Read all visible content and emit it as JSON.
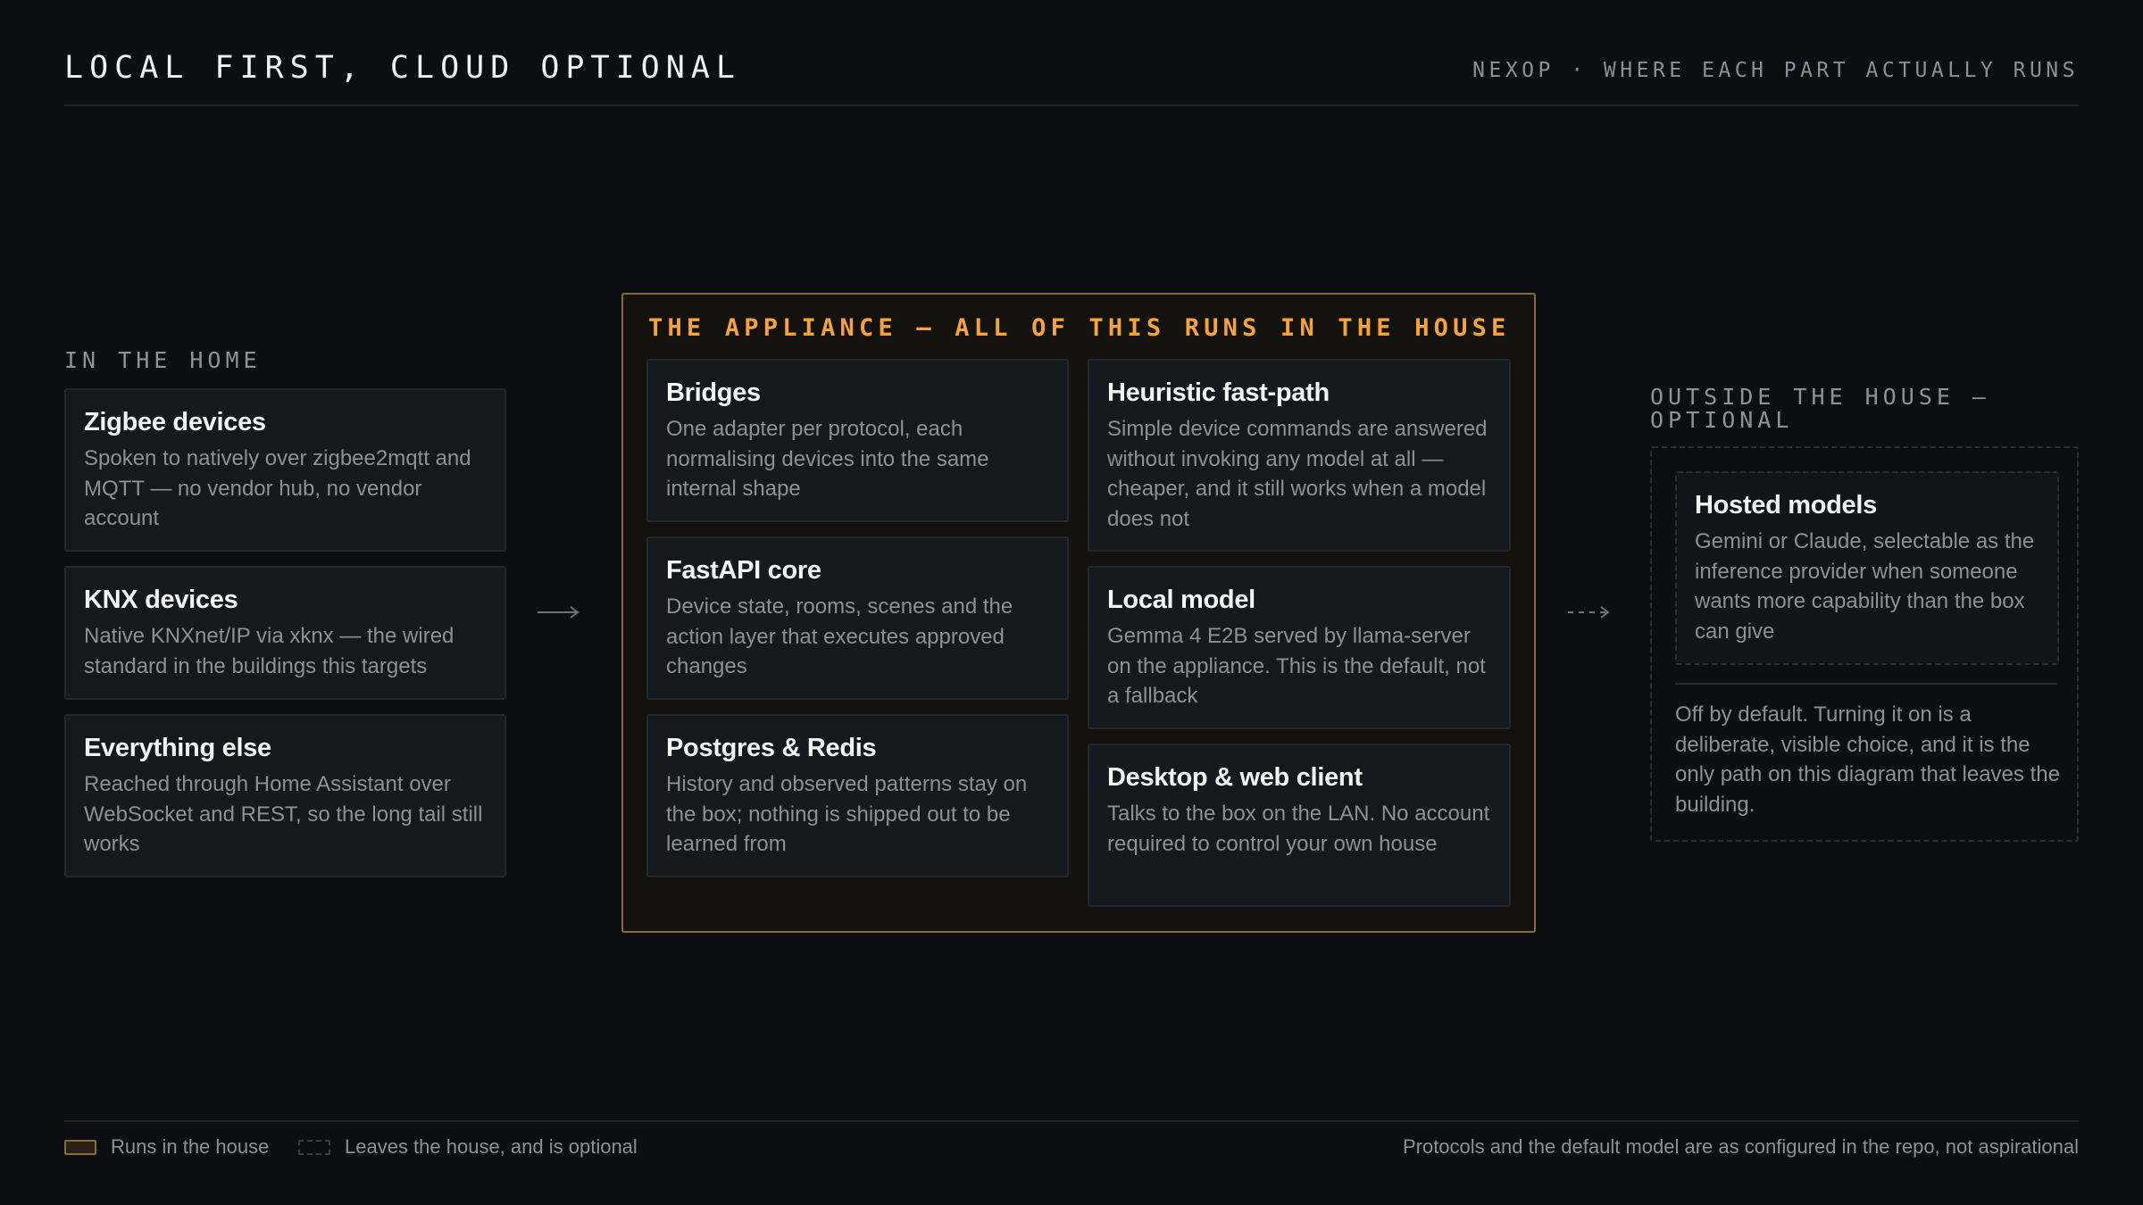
{
  "header": {
    "title": "LOCAL FIRST, CLOUD OPTIONAL",
    "subtitle": "NEXOP · WHERE EACH PART ACTUALLY RUNS"
  },
  "home": {
    "label": "IN THE HOME",
    "cards": [
      {
        "title": "Zigbee devices",
        "body": "Spoken to natively over zigbee2mqtt and MQTT — no vendor hub, no vendor account"
      },
      {
        "title": "KNX devices",
        "body": "Native KNXnet/IP via xknx — the wired standard in the buildings this targets"
      },
      {
        "title": "Everything else",
        "body": "Reached through Home Assistant over WebSocket and REST, so the long tail still works"
      }
    ]
  },
  "appliance": {
    "label": "THE APPLIANCE — ALL OF THIS RUNS IN THE HOUSE",
    "cards": [
      {
        "title": "Bridges",
        "body": "One adapter per protocol, each normalising devices into the same internal shape"
      },
      {
        "title": "FastAPI core",
        "body": "Device state, rooms, scenes and the action layer that executes approved changes"
      },
      {
        "title": "Postgres & Redis",
        "body": "History and observed patterns stay on the box; nothing is shipped out to be learned from"
      },
      {
        "title": "Heuristic fast-path",
        "body": "Simple device commands are answered without invoking any model at all — cheaper, and it still works when a model does not"
      },
      {
        "title": "Local model",
        "body": "Gemma 4 E2B served by llama-server on the appliance. This is the default, not a fallback"
      },
      {
        "title": "Desktop & web client",
        "body": "Talks to the box on the LAN. No account required to control your own house"
      }
    ]
  },
  "outside": {
    "label_line1": "OUTSIDE THE HOUSE —",
    "label_line2": "OPTIONAL",
    "card": {
      "title": "Hosted models",
      "body": "Gemini or Claude, selectable as the inference provider when someone wants more capability than the box can give"
    },
    "note": "Off by default. Turning it on is a deliberate, visible choice, and it is the only path on this diagram that leaves the building."
  },
  "footer": {
    "legend": [
      {
        "label": "Runs in the house",
        "style": "solid",
        "color": "#8a6a37"
      },
      {
        "label": "Leaves the house, and is optional",
        "style": "dashed",
        "color": "#3a3f46"
      }
    ],
    "note": "Protocols and the default model are as configured in the repo, not aspirational"
  },
  "colors": {
    "background": "#0b0e12",
    "accent": "#f5a33c",
    "card": "#15181d",
    "muted_text": "#8c9199"
  }
}
